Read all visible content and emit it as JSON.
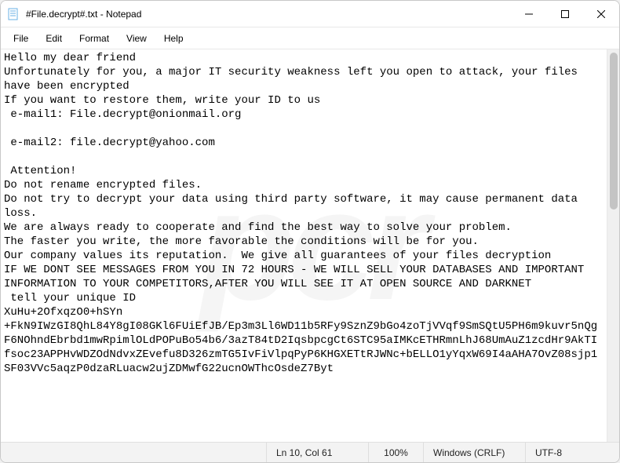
{
  "window": {
    "title": "#File.decrypt#.txt - Notepad"
  },
  "menubar": {
    "file": "File",
    "edit": "Edit",
    "format": "Format",
    "view": "View",
    "help": "Help"
  },
  "content": "Hello my dear friend\nUnfortunately for you, a major IT security weakness left you open to attack, your files have been encrypted\nIf you want to restore them, write your ID to us\n e-mail1: File.decrypt@onionmail.org\n\n e-mail2: file.decrypt@yahoo.com\n\n Attention!\nDo not rename encrypted files.\nDo not try to decrypt your data using third party software, it may cause permanent data loss.\nWe are always ready to cooperate and find the best way to solve your problem.\nThe faster you write, the more favorable the conditions will be for you.\nOur company values its reputation.  We give all guarantees of your files decryption\nIF WE DONT SEE MESSAGES FROM YOU IN 72 HOURS - WE WILL SELL YOUR DATABASES AND IMPORTANT INFORMATION TO YOUR COMPETITORS,AFTER YOU WILL SEE IT AT OPEN SOURCE AND DARKNET\n tell your unique ID\nXuHu+2OfxqzO0+hSYn\n+FkN9IWzGI8QhL84Y8gI08GKl6FUiEfJB/Ep3m3Ll6WD11b5RFy9SznZ9bGo4zoTjVVqf9SmSQtU5PH6m9kuvr5nQgF6NOhndEbrbd1mwRpimlOLdPOPuBo54b6/3azT84tD2IqsbpcgCt6STC95aIMKcETHRmnLhJ68UmAuZ1zcdHr9AkTIfsoc23APPHvWDZOdNdvxZEvefu8D326zmTG5IvFiVlpqPyP6KHGXETtRJWNc+bELLO1yYqxW69I4aAHA7OvZ08sjp1SF03VVc5aqzP0dzaRLuacw2ujZDMwfG22ucnOWThcOsdeZ7Byt",
  "status": {
    "position": "Ln 10, Col 61",
    "zoom": "100%",
    "eol": "Windows (CRLF)",
    "encoding": "UTF-8"
  }
}
